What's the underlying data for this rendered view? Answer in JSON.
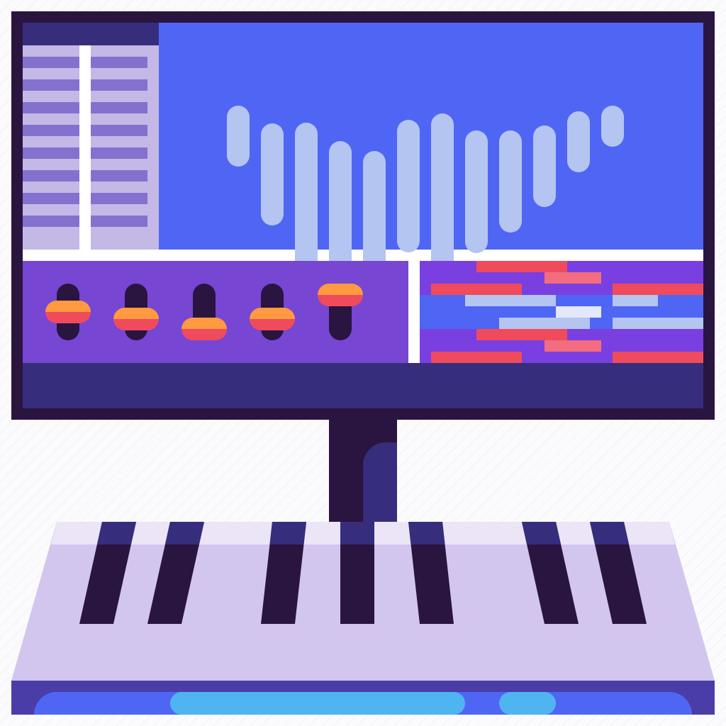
{
  "icon": {
    "name": "digital-audio-workstation-icon",
    "colors": {
      "outline": "#2a1440",
      "deep_navy": "#362d7c",
      "screen_blue": "#4f66f4",
      "wave_bar": "#b3c5f0",
      "mixer_purple": "#7746d3",
      "piano_roll_purple": "#7a3fe0",
      "lavender": "#c4b8e6",
      "list_row": "#8570ce",
      "fader_orange": "#ff9a40",
      "fader_red": "#ef4b5c",
      "note_pink": "#f36c80",
      "note_pale": "#e3e8fb",
      "keyboard_body": "#d3c6ee",
      "keyboard_base": "#4b3da8",
      "keyboard_strip": "#4f66f4",
      "keyboard_light": "#4fb5f1"
    },
    "monitor": {
      "browser_row_count": 8,
      "waveform": {
        "bar_count": 12,
        "bar_levels": [
          0.3,
          0.5,
          0.8,
          0.8,
          0.65,
          0.65,
          0.85,
          0.6,
          0.5,
          0.4,
          0.3,
          0.2
        ]
      },
      "mixer": {
        "fader_count": 5,
        "fader_positions": [
          0.5,
          0.3,
          0.0,
          0.3,
          1.0
        ]
      },
      "piano_roll": {
        "note_colors": [
          "red",
          "pink",
          "pale-blue",
          "white"
        ]
      }
    },
    "keyboard": {
      "black_key_count": 7,
      "display_lights": 2
    }
  }
}
